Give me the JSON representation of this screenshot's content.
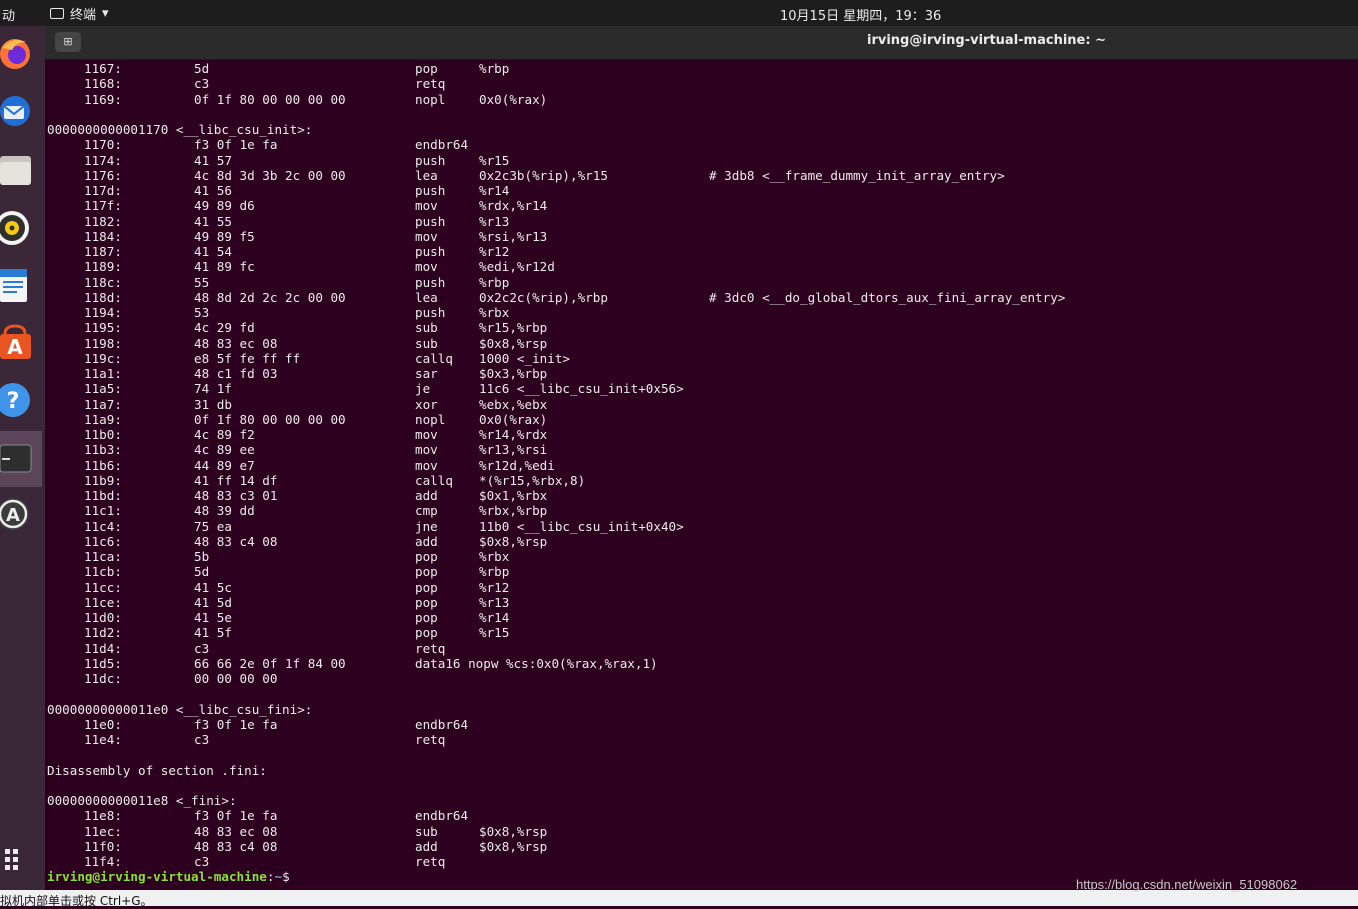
{
  "topbar": {
    "activities": "动",
    "app_name": "终端",
    "clock": "10月15日 星期四，19：36"
  },
  "window": {
    "title": "irving@irving-virtual-machine: ~"
  },
  "colors": {
    "terminal_bg": "#2c001e",
    "prompt_user": "#8ae234",
    "prompt_path": "#729fcf"
  },
  "dock": [
    "firefox-icon",
    "thunderbird-icon",
    "files-icon",
    "rhythmbox-icon",
    "libreoffice-writer-icon",
    "software-center-icon",
    "help-icon",
    "terminal-icon",
    "software-updater-icon",
    "app-grid-icon"
  ],
  "lines": [
    {
      "addr": "1167:",
      "hex": "5d",
      "mn": "pop",
      "op": "%rbp"
    },
    {
      "addr": "1168:",
      "hex": "c3",
      "mn": "retq"
    },
    {
      "addr": "1169:",
      "hex": "0f 1f 80 00 00 00 00",
      "mn": "nopl",
      "op": "0x0(%rax)"
    },
    {
      "text": ""
    },
    {
      "text": "0000000000001170 <__libc_csu_init>:"
    },
    {
      "addr": "1170:",
      "hex": "f3 0f 1e fa",
      "mn": "endbr64"
    },
    {
      "addr": "1174:",
      "hex": "41 57",
      "mn": "push",
      "op": "%r15"
    },
    {
      "addr": "1176:",
      "hex": "4c 8d 3d 3b 2c 00 00",
      "mn": "lea",
      "op": "0x2c3b(%rip),%r15",
      "cm": "# 3db8 <__frame_dummy_init_array_entry>"
    },
    {
      "addr": "117d:",
      "hex": "41 56",
      "mn": "push",
      "op": "%r14"
    },
    {
      "addr": "117f:",
      "hex": "49 89 d6",
      "mn": "mov",
      "op": "%rdx,%r14"
    },
    {
      "addr": "1182:",
      "hex": "41 55",
      "mn": "push",
      "op": "%r13"
    },
    {
      "addr": "1184:",
      "hex": "49 89 f5",
      "mn": "mov",
      "op": "%rsi,%r13"
    },
    {
      "addr": "1187:",
      "hex": "41 54",
      "mn": "push",
      "op": "%r12"
    },
    {
      "addr": "1189:",
      "hex": "41 89 fc",
      "mn": "mov",
      "op": "%edi,%r12d"
    },
    {
      "addr": "118c:",
      "hex": "55",
      "mn": "push",
      "op": "%rbp"
    },
    {
      "addr": "118d:",
      "hex": "48 8d 2d 2c 2c 00 00",
      "mn": "lea",
      "op": "0x2c2c(%rip),%rbp",
      "cm": "# 3dc0 <__do_global_dtors_aux_fini_array_entry>"
    },
    {
      "addr": "1194:",
      "hex": "53",
      "mn": "push",
      "op": "%rbx"
    },
    {
      "addr": "1195:",
      "hex": "4c 29 fd",
      "mn": "sub",
      "op": "%r15,%rbp"
    },
    {
      "addr": "1198:",
      "hex": "48 83 ec 08",
      "mn": "sub",
      "op": "$0x8,%rsp"
    },
    {
      "addr": "119c:",
      "hex": "e8 5f fe ff ff",
      "mn": "callq",
      "op": "1000 <_init>"
    },
    {
      "addr": "11a1:",
      "hex": "48 c1 fd 03",
      "mn": "sar",
      "op": "$0x3,%rbp"
    },
    {
      "addr": "11a5:",
      "hex": "74 1f",
      "mn": "je",
      "op": "11c6 <__libc_csu_init+0x56>"
    },
    {
      "addr": "11a7:",
      "hex": "31 db",
      "mn": "xor",
      "op": "%ebx,%ebx"
    },
    {
      "addr": "11a9:",
      "hex": "0f 1f 80 00 00 00 00",
      "mn": "nopl",
      "op": "0x0(%rax)"
    },
    {
      "addr": "11b0:",
      "hex": "4c 89 f2",
      "mn": "mov",
      "op": "%r14,%rdx"
    },
    {
      "addr": "11b3:",
      "hex": "4c 89 ee",
      "mn": "mov",
      "op": "%r13,%rsi"
    },
    {
      "addr": "11b6:",
      "hex": "44 89 e7",
      "mn": "mov",
      "op": "%r12d,%edi"
    },
    {
      "addr": "11b9:",
      "hex": "41 ff 14 df",
      "mn": "callq",
      "op": "*(%r15,%rbx,8)"
    },
    {
      "addr": "11bd:",
      "hex": "48 83 c3 01",
      "mn": "add",
      "op": "$0x1,%rbx"
    },
    {
      "addr": "11c1:",
      "hex": "48 39 dd",
      "mn": "cmp",
      "op": "%rbx,%rbp"
    },
    {
      "addr": "11c4:",
      "hex": "75 ea",
      "mn": "jne",
      "op": "11b0 <__libc_csu_init+0x40>"
    },
    {
      "addr": "11c6:",
      "hex": "48 83 c4 08",
      "mn": "add",
      "op": "$0x8,%rsp"
    },
    {
      "addr": "11ca:",
      "hex": "5b",
      "mn": "pop",
      "op": "%rbx"
    },
    {
      "addr": "11cb:",
      "hex": "5d",
      "mn": "pop",
      "op": "%rbp"
    },
    {
      "addr": "11cc:",
      "hex": "41 5c",
      "mn": "pop",
      "op": "%r12"
    },
    {
      "addr": "11ce:",
      "hex": "41 5d",
      "mn": "pop",
      "op": "%r13"
    },
    {
      "addr": "11d0:",
      "hex": "41 5e",
      "mn": "pop",
      "op": "%r14"
    },
    {
      "addr": "11d2:",
      "hex": "41 5f",
      "mn": "pop",
      "op": "%r15"
    },
    {
      "addr": "11d4:",
      "hex": "c3",
      "mn": "retq"
    },
    {
      "addr": "11d5:",
      "hex": "66 66 2e 0f 1f 84 00",
      "mn": "data16 nopw %cs:0x0(%rax,%rax,1)"
    },
    {
      "addr": "11dc:",
      "hex": "00 00 00 00"
    },
    {
      "text": ""
    },
    {
      "text": "00000000000011e0 <__libc_csu_fini>:"
    },
    {
      "addr": "11e0:",
      "hex": "f3 0f 1e fa",
      "mn": "endbr64"
    },
    {
      "addr": "11e4:",
      "hex": "c3",
      "mn": "retq"
    },
    {
      "text": ""
    },
    {
      "text": "Disassembly of section .fini:"
    },
    {
      "text": ""
    },
    {
      "text": "00000000000011e8 <_fini>:"
    },
    {
      "addr": "11e8:",
      "hex": "f3 0f 1e fa",
      "mn": "endbr64"
    },
    {
      "addr": "11ec:",
      "hex": "48 83 ec 08",
      "mn": "sub",
      "op": "$0x8,%rsp"
    },
    {
      "addr": "11f0:",
      "hex": "48 83 c4 08",
      "mn": "add",
      "op": "$0x8,%rsp"
    },
    {
      "addr": "11f4:",
      "hex": "c3",
      "mn": "retq"
    }
  ],
  "prompt": {
    "user": "irving@irving-virtual-machine",
    "sep": ":",
    "path": "~",
    "symbol": "$"
  },
  "statusbar": {
    "hint": "拟机内部单击或按 Ctrl+G。"
  },
  "watermark": "https://blog.csdn.net/weixin_51098062"
}
